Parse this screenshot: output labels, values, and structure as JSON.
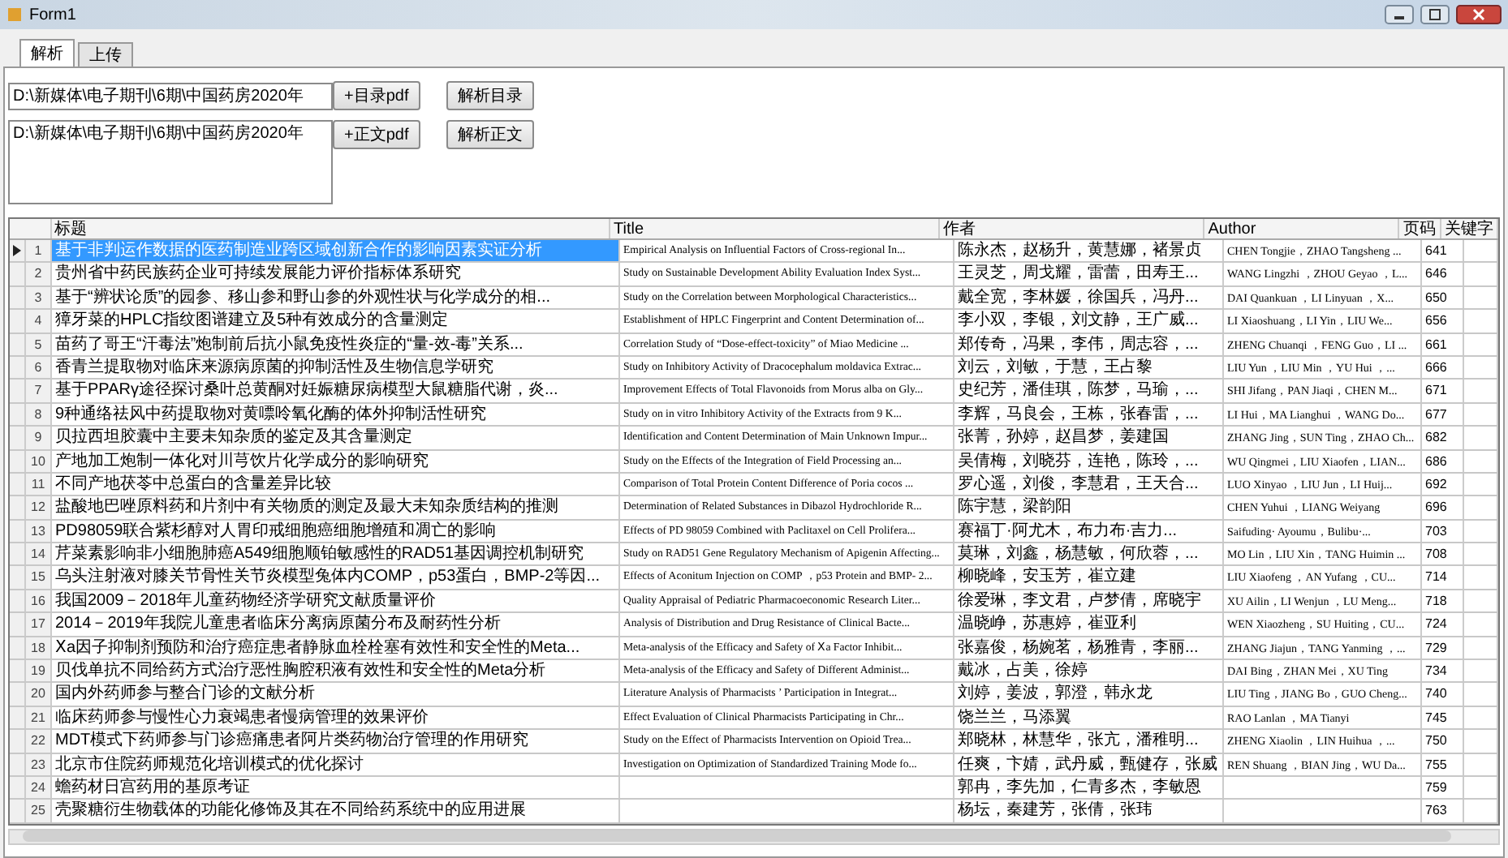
{
  "window": {
    "title": "Form1"
  },
  "tabs": [
    {
      "label": "解析",
      "selected": true
    },
    {
      "label": "上传",
      "selected": false
    }
  ],
  "toc": {
    "path": "D:\\新媒体\\电子期刊\\6期\\中国药房2020年",
    "add_button": "+目录pdf",
    "parse_button": "解析目录"
  },
  "body": {
    "path": "D:\\新媒体\\电子期刊\\6期\\中国药房2020年",
    "add_button": "+正文pdf",
    "parse_button": "解析正文"
  },
  "table": {
    "columns": [
      "标题",
      "Title",
      "作者",
      "Author",
      "页码",
      "关键字"
    ],
    "rows": [
      {
        "number": "1",
        "title_cn": "基于非判运作数据的医药制造业跨区域创新合作的影响因素实证分析",
        "title_en": "Empirical Analysis on Influential Factors of Cross-regional In...",
        "authors_cn": "陈永杰，赵杨升，黄慧娜，褚景贞",
        "authors_en": "CHEN Tongjie，ZHAO Tangsheng ...",
        "page": "641",
        "selected": true
      },
      {
        "number": "2",
        "title_cn": "贵州省中药民族药企业可持续发展能力评价指标体系研究",
        "title_en": "Study on Sustainable Development Ability Evaluation Index Syst...",
        "authors_cn": "王灵芝，周戈耀，雷蕾，田寿王...",
        "authors_en": "WANG Lingzhi ，ZHOU Geyao ，L...",
        "page": "646",
        "selected": false
      },
      {
        "number": "3",
        "title_cn": "基于“辨状论质”的园参、移山参和野山参的外观性状与化学成分的相...",
        "title_en": "Study on the Correlation between Morphological Characteristics...",
        "authors_cn": "戴全宽，李林媛，徐国兵，冯丹...",
        "authors_en": "DAI Quankuan ，LI Linyuan ，X...",
        "page": "650",
        "selected": false
      },
      {
        "number": "4",
        "title_cn": "獐牙菜的HPLC指纹图谱建立及5种有效成分的含量测定",
        "title_en": "Establishment of HPLC Fingerprint and Content Determination of...",
        "authors_cn": "李小双，李银，刘文静，王广威...",
        "authors_en": "LI Xiaoshuang，LI Yin，LIU We...",
        "page": "656",
        "selected": false
      },
      {
        "number": "5",
        "title_cn": "苗药了哥王“汗毒法”炮制前后抗小鼠免疫性炎症的“量-效-毒”关系...",
        "title_en": "Correlation Study of “Dose-effect-toxicity” of Miao Medicine ...",
        "authors_cn": "郑传奇，冯果，李伟，周志容，...",
        "authors_en": "ZHENG Chuanqi ，FENG Guo，LI ...",
        "page": "661",
        "selected": false
      },
      {
        "number": "6",
        "title_cn": "香青兰提取物对临床来源病原菌的抑制活性及生物信息学研究",
        "title_en": "Study on Inhibitory Activity of Dracocephalum moldavica Extrac...",
        "authors_cn": "刘云，刘敏，于慧，王占黎",
        "authors_en": "LIU Yun ，LIU Min ，YU Hui ，...",
        "page": "666",
        "selected": false
      },
      {
        "number": "7",
        "title_cn": "基于PPARγ途径探讨桑叶总黄酮对妊娠糖尿病模型大鼠糖脂代谢，炎...",
        "title_en": "Improvement Effects of Total Flavonoids from Morus alba on Gly...",
        "authors_cn": "史纪芳，潘佳琪，陈梦，马瑜，...",
        "authors_en": "SHI Jifang，PAN Jiaqi，CHEN M...",
        "page": "671",
        "selected": false
      },
      {
        "number": "8",
        "title_cn": "9种通络祛风中药提取物对黄嘌呤氧化酶的体外抑制活性研究",
        "title_en": "Study on in vitro Inhibitory Activity of the Extracts from 9 K...",
        "authors_cn": "李辉，马良会，王栋，张春雷，...",
        "authors_en": "LI Hui，MA Lianghui ，WANG Do...",
        "page": "677",
        "selected": false
      },
      {
        "number": "9",
        "title_cn": "贝拉西坦胶囊中主要未知杂质的鉴定及其含量测定",
        "title_en": "Identification and Content Determination of Main Unknown Impur...",
        "authors_cn": "张菁，孙婷，赵昌梦，姜建国",
        "authors_en": "ZHANG Jing，SUN Ting，ZHAO Ch...",
        "page": "682",
        "selected": false
      },
      {
        "number": "10",
        "title_cn": "产地加工炮制一体化对川芎饮片化学成分的影响研究",
        "title_en": "Study on the Effects of the Integration of Field Processing an...",
        "authors_cn": "吴倩梅，刘晓芬，连艳，陈玲，...",
        "authors_en": "WU Qingmei，LIU Xiaofen，LIAN...",
        "page": "686",
        "selected": false
      },
      {
        "number": "11",
        "title_cn": "不同产地茯苓中总蛋白的含量差异比较",
        "title_en": "Comparison of Total Protein Content Difference of Poria cocos ...",
        "authors_cn": "罗心遥，刘俊，李慧君，王天合...",
        "authors_en": "LUO Xinyao ，LIU Jun，LI Huij...",
        "page": "692",
        "selected": false
      },
      {
        "number": "12",
        "title_cn": "盐酸地巴唑原料药和片剂中有关物质的测定及最大未知杂质结构的推测",
        "title_en": "Determination of Related Substances in Dibazol Hydrochloride R...",
        "authors_cn": "陈宇慧，梁韵阳",
        "authors_en": "CHEN Yuhui ，LIANG Weiyang",
        "page": "696",
        "selected": false
      },
      {
        "number": "13",
        "title_cn": "PD98059联合紫杉醇对人胃印戒细胞癌细胞增殖和凋亡的影响",
        "title_en": "Effects of PD 98059 Combined with Paclitaxel on Cell Prolifera...",
        "authors_cn": "赛福丁·阿尤木，布力布·吉力...",
        "authors_en": "Saifuding· Ayoumu，Bulibu·...",
        "page": "703",
        "selected": false
      },
      {
        "number": "14",
        "title_cn": "芹菜素影响非小细胞肺癌A549细胞顺铂敏感性的RAD51基因调控机制研究",
        "title_en": "Study on RAD51 Gene Regulatory Mechanism of Apigenin Affecting...",
        "authors_cn": "莫琳，刘鑫，杨慧敏，何欣蓉，...",
        "authors_en": "MO Lin，LIU Xin，TANG Huimin ...",
        "page": "708",
        "selected": false
      },
      {
        "number": "15",
        "title_cn": "乌头注射液对膝关节骨性关节炎模型兔体内COMP，p53蛋白，BMP-2等因...",
        "title_en": "Effects of Aconitum Injection on COMP ，p53 Protein and BMP- 2...",
        "authors_cn": "柳晓峰，安玉芳，崔立建",
        "authors_en": "LIU Xiaofeng ，AN Yufang ，CU...",
        "page": "714",
        "selected": false
      },
      {
        "number": "16",
        "title_cn": "我国2009－2018年儿童药物经济学研究文献质量评价",
        "title_en": "Quality Appraisal of Pediatric Pharmacoeconomic Research Liter...",
        "authors_cn": "徐爱琳，李文君，卢梦倩，席晓宇",
        "authors_en": "XU Ailin，LI Wenjun ，LU Meng...",
        "page": "718",
        "selected": false
      },
      {
        "number": "17",
        "title_cn": "2014－2019年我院儿童患者临床分离病原菌分布及耐药性分析",
        "title_en": "Analysis of Distribution and Drug Resistance of Clinical Bacte...",
        "authors_cn": "温晓峥，苏惠婷，崔亚利",
        "authors_en": "WEN Xiaozheng，SU Huiting，CU...",
        "page": "724",
        "selected": false
      },
      {
        "number": "18",
        "title_cn": "Ⅹa因子抑制剂预防和治疗癌症患者静脉血栓栓塞有效性和安全性的Meta...",
        "title_en": "Meta-analysis of the Efficacy and Safety of Ⅹa Factor Inhibit...",
        "authors_cn": "张嘉俊，杨婉茗，杨雅青，李丽...",
        "authors_en": "ZHANG Jiajun，TANG Yanming ，...",
        "page": "729",
        "selected": false
      },
      {
        "number": "19",
        "title_cn": "贝伐单抗不同给药方式治疗恶性胸腔积液有效性和安全性的Meta分析",
        "title_en": "Meta-analysis of the Efficacy and Safety of Different Administ...",
        "authors_cn": "戴冰，占美，徐婷",
        "authors_en": "DAI Bing，ZHAN Mei，XU Ting",
        "page": "734",
        "selected": false
      },
      {
        "number": "20",
        "title_cn": "国内外药师参与整合门诊的文献分析",
        "title_en": "Literature Analysis of Pharmacists ’ Participation in Integrat...",
        "authors_cn": "刘婷，姜波，郭澄，韩永龙",
        "authors_en": "LIU Ting，JIANG Bo，GUO Cheng...",
        "page": "740",
        "selected": false
      },
      {
        "number": "21",
        "title_cn": "临床药师参与慢性心力衰竭患者慢病管理的效果评价",
        "title_en": "Effect Evaluation of Clinical Pharmacists Participating in Chr...",
        "authors_cn": "饶兰兰，马添翼",
        "authors_en": "RAO Lanlan ，MA Tianyi",
        "page": "745",
        "selected": false
      },
      {
        "number": "22",
        "title_cn": "MDT模式下药师参与门诊癌痛患者阿片类药物治疗管理的作用研究",
        "title_en": "Study on the Effect of Pharmacists Intervention on Opioid Trea...",
        "authors_cn": "郑晓林，林慧华，张亢，潘稚明...",
        "authors_en": "ZHENG Xiaolin ，LIN Huihua ，...",
        "page": "750",
        "selected": false
      },
      {
        "number": "23",
        "title_cn": "北京市住院药师规范化培训模式的优化探讨",
        "title_en": "Investigation on Optimization of Standardized Training Mode fo...",
        "authors_cn": "任爽，卞婧，武丹威，甄健存，张威",
        "authors_en": "REN Shuang ，BIAN Jing，WU Da...",
        "page": "755",
        "selected": false
      },
      {
        "number": "24",
        "title_cn": "蟾药材日宫药用的基原考证",
        "authors_cn": "郭冉，李先加，仁青多杰，李敏恩",
        "page": "759",
        "selected": false
      },
      {
        "number": "25",
        "title_cn": "壳聚糖衍生物载体的功能化修饰及其在不同给药系统中的应用进展",
        "authors_cn": "杨坛，秦建芳，张倩，张玮",
        "page": "763",
        "selected": false
      }
    ]
  }
}
